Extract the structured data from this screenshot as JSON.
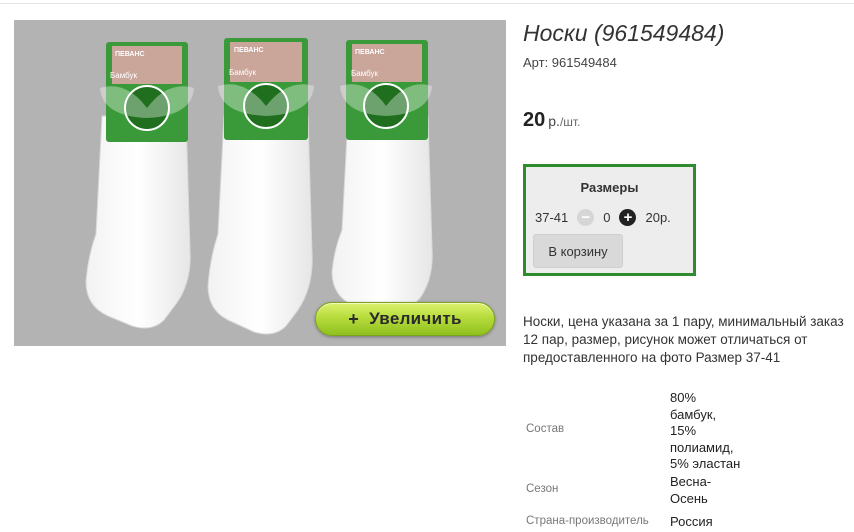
{
  "product": {
    "title": "Носки (961549484)",
    "sku": "Арт: 961549484",
    "price_value": "20",
    "price_currency": "р.",
    "price_unit": "/шт."
  },
  "photo": {
    "zoom_label": "Увеличить",
    "zoom_icon": "plus-icon",
    "package_brand": "ПЕВАНС",
    "package_material": "Бамбук",
    "background_color": "#b3b3b3",
    "package_color": "#2e8b2e"
  },
  "sizes": {
    "title": "Размеры",
    "rows": [
      {
        "size": "37-41",
        "qty": "0",
        "price": "20р."
      }
    ],
    "minus_icon": "minus-circle-icon",
    "plus_icon": "plus-circle-icon",
    "cart_label": "В корзину",
    "border_color": "#2d8c2d"
  },
  "description": "Носки, цена указана за 1 пару, минимальный заказ 12 пар, размер, рисунок может отличаться от предоставленного на фото Размер 37-41",
  "specs": [
    {
      "label": "Состав",
      "value": [
        "80%",
        "бамбук,",
        "15%",
        "полиамид,",
        "5% эластан"
      ]
    },
    {
      "label": "Сезон",
      "value": [
        "Весна-",
        "Осень"
      ]
    },
    {
      "label": "Страна-производитель",
      "value": [
        "Россия"
      ]
    }
  ]
}
